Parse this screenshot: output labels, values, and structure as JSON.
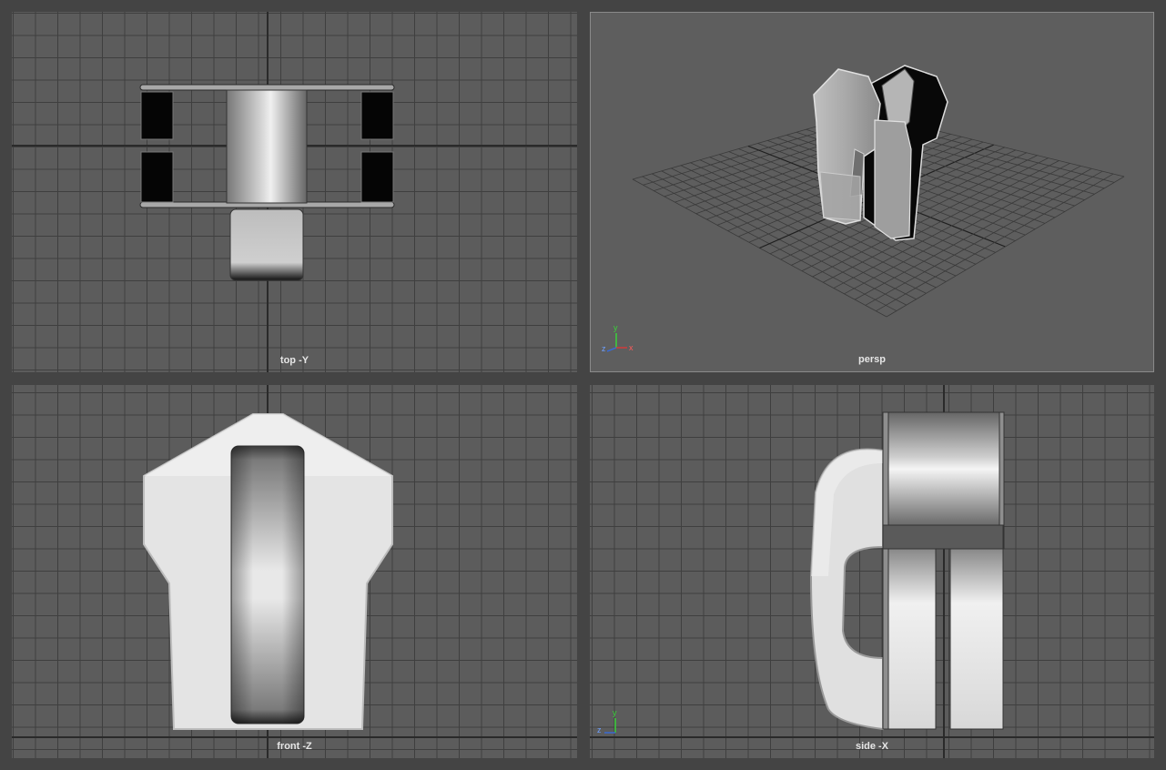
{
  "viewports": {
    "top": {
      "label": "top -Y"
    },
    "persp": {
      "label": "persp"
    },
    "front": {
      "label": "front -Z"
    },
    "side": {
      "label": "side -X"
    }
  },
  "gizmos": {
    "persp": {
      "y": "y",
      "z": "z",
      "x": "x"
    },
    "side": {
      "y": "y",
      "z": "z"
    }
  },
  "colors": {
    "background": "#444444",
    "viewport": "#5c5c5c",
    "grid": "#3f3f3f",
    "axis_x": "#d23a3a",
    "axis_y": "#3ad23a",
    "axis_z": "#3a6ad2"
  }
}
